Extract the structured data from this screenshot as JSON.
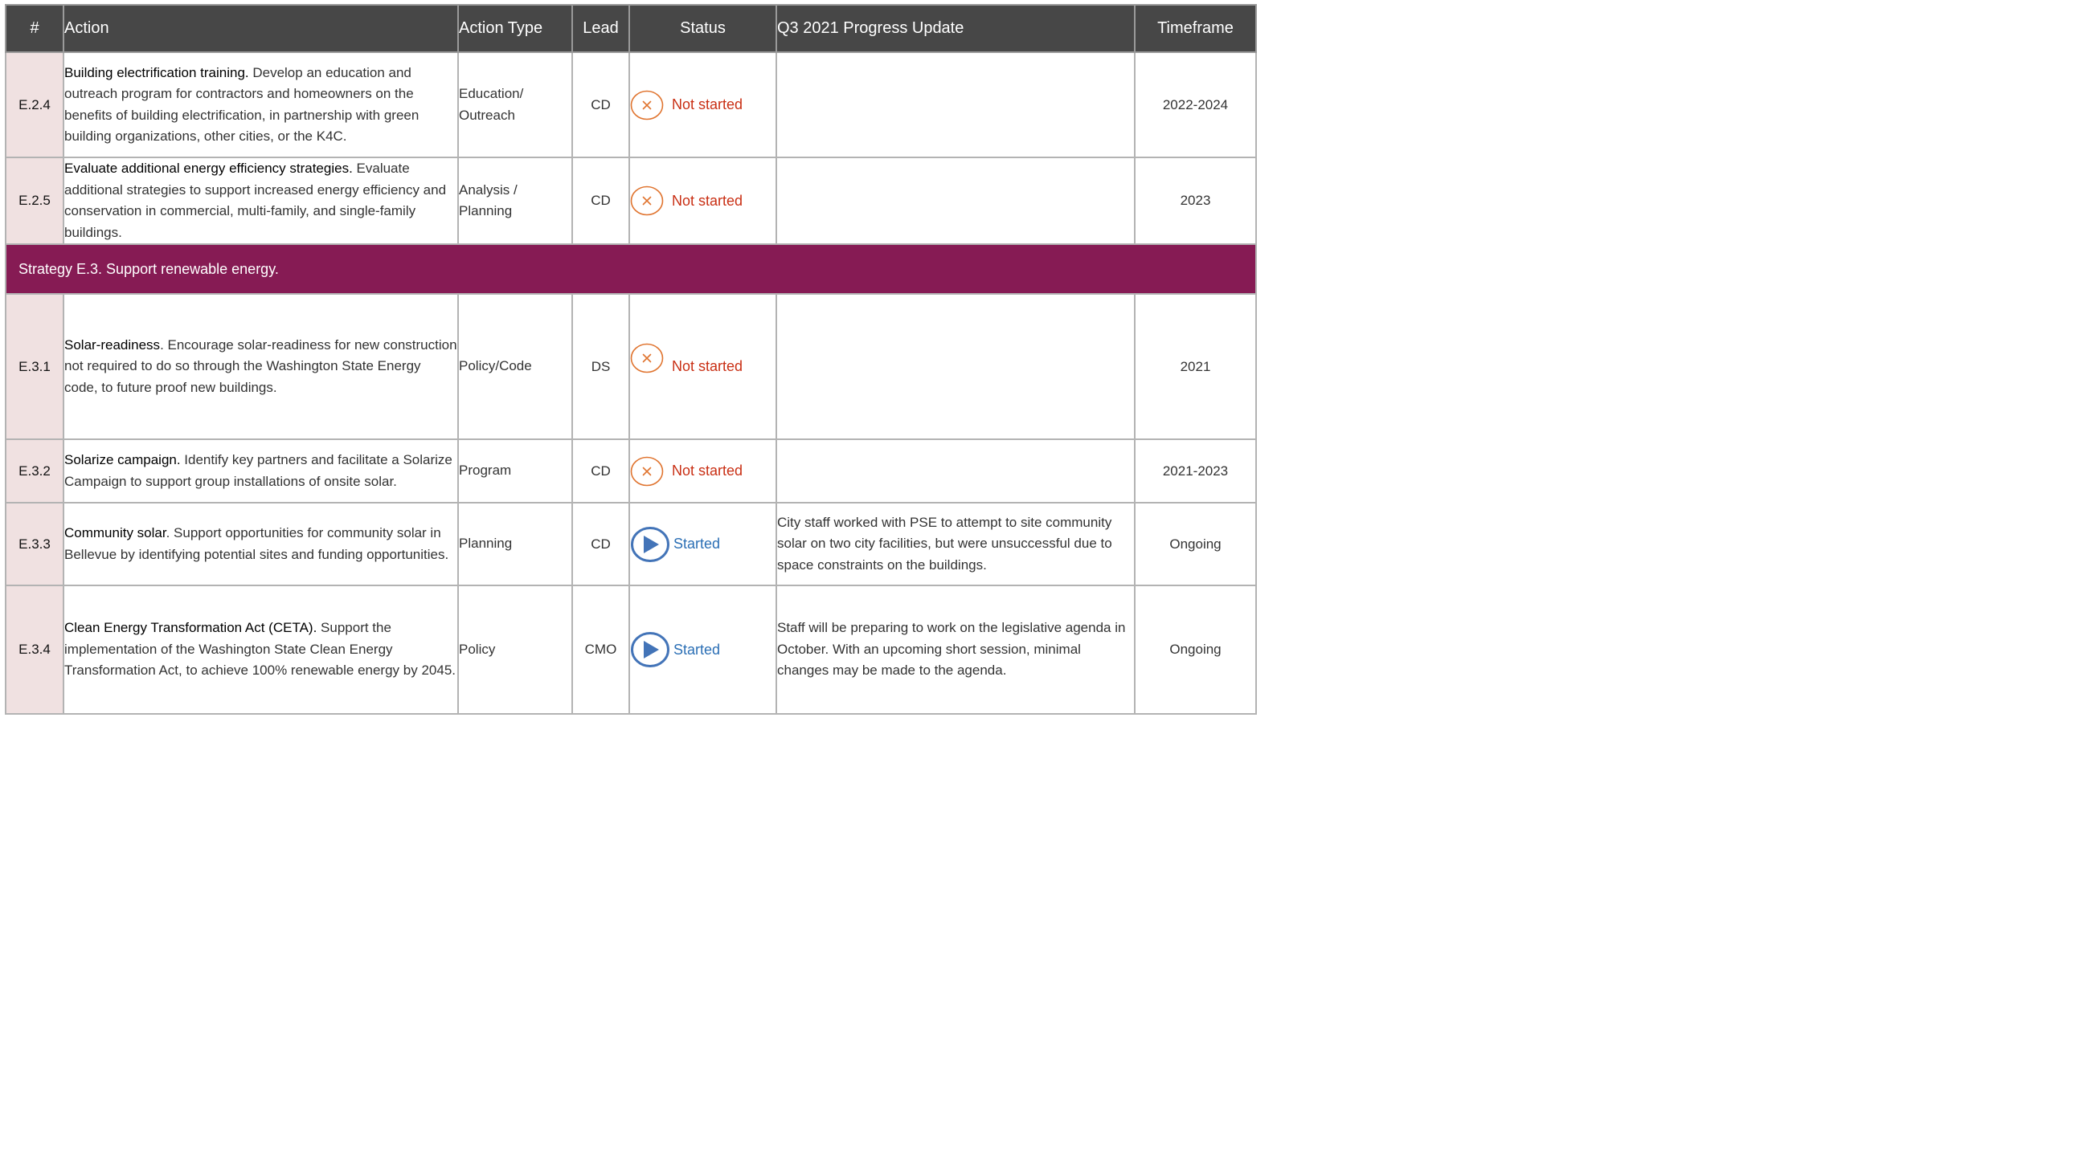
{
  "headers": {
    "num": "#",
    "action": "Action",
    "action_type": "Action Type",
    "lead": "Lead",
    "status": "Status",
    "progress": "Q3 2021 Progress Update",
    "timeframe": "Timeframe"
  },
  "colors": {
    "header_bg": "#474747",
    "strategy_bg": "#861b54",
    "id_cell_bg": "#f0e1e1",
    "not_started": "#c92f14",
    "not_started_icon": "#e0742f",
    "started": "#2b6fb5"
  },
  "rows": [
    {
      "id": "E.2.4",
      "title": "Building electrification training.",
      "desc": " Develop an education and outreach program for contractors and homeowners on the benefits of building electrification, in partnership with green building organizations, other cities, or the K4C.",
      "type": "Education/ Outreach",
      "lead": "CD",
      "status": "Not started",
      "status_icon": "x-circle-icon",
      "progress": "",
      "timeframe": "2022-2024"
    },
    {
      "id": "E.2.5",
      "title": "Evaluate additional energy efficiency strategies.",
      "desc": " Evaluate additional strategies to support increased energy efficiency and conservation in commercial, multi-family, and single-family buildings.",
      "type": "Analysis / Planning",
      "lead": "CD",
      "status": "Not started",
      "status_icon": "x-circle-icon",
      "progress": "",
      "timeframe": "2023"
    }
  ],
  "strategy": {
    "label": "Strategy E.3. Support renewable energy."
  },
  "rows2": [
    {
      "id": "E.3.1",
      "title": "Solar-readiness",
      "desc": ". Encourage solar-readiness for new construction not required to do so through the Washington State Energy code, to future proof new buildings.",
      "type": "Policy/Code",
      "lead": "DS",
      "status": "Not started",
      "status_icon": "x-circle-icon",
      "progress": "",
      "timeframe": "2021"
    },
    {
      "id": "E.3.2",
      "title": "Solarize campaign.",
      "desc": " Identify key partners and facilitate a Solarize Campaign to support group installations of onsite solar.",
      "type": "Program",
      "lead": "CD",
      "status": "Not started",
      "status_icon": "x-circle-icon",
      "progress": "",
      "timeframe": "2021-2023"
    },
    {
      "id": "E.3.3",
      "title": "Community solar",
      "desc": ". Support opportunities for community solar in Bellevue by identifying potential sites and funding opportunities.",
      "type": "Planning",
      "lead": "CD",
      "status": "Started",
      "status_icon": "play-circle-icon",
      "progress": "City staff worked with PSE to attempt to site community solar on two city facilities, but were unsuccessful due to space constraints on the buildings.",
      "timeframe": "Ongoing"
    },
    {
      "id": "E.3.4",
      "title": "Clean Energy Transformation Act (CETA).",
      "desc": " Support the implementation of the Washington State Clean Energy Transformation Act, to achieve 100% renewable energy by 2045.",
      "type": "Policy",
      "lead": "CMO",
      "status": "Started",
      "status_icon": "play-circle-icon",
      "progress": "Staff will be preparing to work on the legislative agenda in October. With an upcoming short session, minimal changes may be made to the agenda.",
      "timeframe": "Ongoing"
    }
  ]
}
